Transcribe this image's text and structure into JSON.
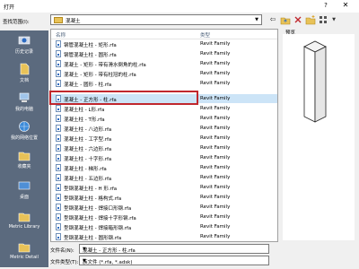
{
  "window": {
    "title": "打开",
    "help": "?",
    "close": "✕"
  },
  "lookin": {
    "label": "查找范围(I):",
    "value": "混凝土"
  },
  "toolbar": {
    "back_icon": "back-icon",
    "up_icon": "up-folder-icon",
    "delete_icon": "delete-icon",
    "newfolder_icon": "new-folder-icon",
    "views_icon": "views-icon"
  },
  "preview": {
    "label": "预览"
  },
  "places": [
    {
      "label": "历史记录",
      "icon": "history-icon"
    },
    {
      "label": "文档",
      "icon": "documents-icon"
    },
    {
      "label": "我的电脑",
      "icon": "my-computer-icon"
    },
    {
      "label": "我的网络位置",
      "icon": "network-icon"
    },
    {
      "label": "收藏夹",
      "icon": "favorites-icon"
    },
    {
      "label": "桌面",
      "icon": "desktop-icon"
    },
    {
      "label": "Metric Library",
      "icon": "library-folder-icon"
    },
    {
      "label": "Metric Detail",
      "icon": "library-folder-icon"
    }
  ],
  "list": {
    "headers": {
      "name": "名称",
      "type": "类型"
    },
    "rows": [
      {
        "name": "钢管混凝土柱 - 矩形.rfa",
        "type": "Revit Family"
      },
      {
        "name": "钢管混凝土柱 - 圆形.rfa",
        "type": "Revit Family"
      },
      {
        "name": "混凝土 - 矩形 - 带有滑水倒角的柱.rfa",
        "type": "Revit Family"
      },
      {
        "name": "混凝土 - 矩形 - 带有柱冠的柱.rfa",
        "type": "Revit Family"
      },
      {
        "name": "混凝土 - 圆形 - 柱.rfa",
        "type": "Revit Family"
      },
      {
        "name": "混凝土 - 正方形 - 柱.rfa",
        "type": "Revit Family"
      },
      {
        "name": "混凝土柱 - L形.rfa",
        "type": "Revit Family"
      },
      {
        "name": "混凝土柱 - T形.rfa",
        "type": "Revit Family"
      },
      {
        "name": "混凝土柱 - 八边形.rfa",
        "type": "Revit Family"
      },
      {
        "name": "混凝土柱 - 工字型.rfa",
        "type": "Revit Family"
      },
      {
        "name": "混凝土柱 - 六边形.rfa",
        "type": "Revit Family"
      },
      {
        "name": "混凝土柱 - 十字形.rfa",
        "type": "Revit Family"
      },
      {
        "name": "混凝土柱 - 梯形.rfa",
        "type": "Revit Family"
      },
      {
        "name": "混凝土柱 - 五边形.rfa",
        "type": "Revit Family"
      },
      {
        "name": "型钢混凝土柱 - H 形.rfa",
        "type": "Revit Family"
      },
      {
        "name": "型钢混凝土柱 - 格构式.rfa",
        "type": "Revit Family"
      },
      {
        "name": "型钢混凝土柱 - 焊接口形钢.rfa",
        "type": "Revit Family"
      },
      {
        "name": "型钢混凝土柱 - 焊接十字形钢.rfa",
        "type": "Revit Family"
      },
      {
        "name": "型钢混凝土柱 - 焊接箱形钢.rfa",
        "type": "Revit Family"
      },
      {
        "name": "型钢混凝土柱 - 圆形钢.rfa",
        "type": "Revit Family"
      }
    ]
  },
  "filename": {
    "label": "文件名(N):",
    "value": "混凝土 - 正方形 - 柱.rfa"
  },
  "filetype": {
    "label": "文件类型(T):",
    "value": "族文件 (*.rfa, *.adsk)"
  }
}
